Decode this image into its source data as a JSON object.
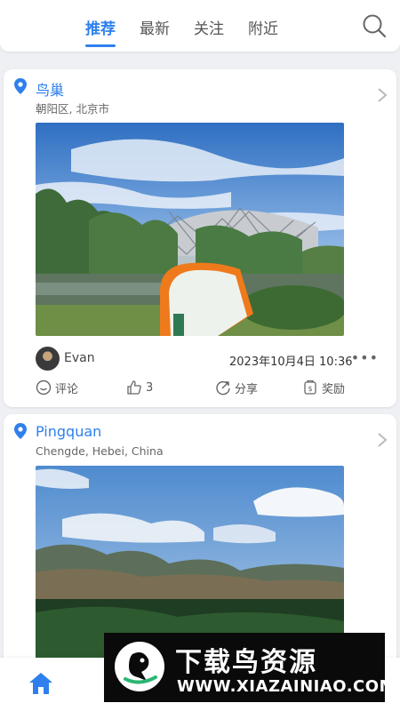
{
  "top_nav": {
    "tabs": [
      {
        "label": "推荐",
        "active": true
      },
      {
        "label": "最新",
        "active": false
      },
      {
        "label": "关注",
        "active": false
      },
      {
        "label": "附近",
        "active": false
      }
    ],
    "search_icon": "search-icon",
    "accent_color": "#2f80ed"
  },
  "posts": [
    {
      "place": "鸟巢",
      "address": "朝阳区, 北京市",
      "photo": "Beijing National Stadium (Bird's Nest) with trees and a curved signboard",
      "author": "Evan",
      "datetime": "2023年10月4日 10:36",
      "more": "•••",
      "actions": {
        "comment": "评论",
        "like_count": "3",
        "share": "分享",
        "reward": "奖励"
      }
    },
    {
      "place": "Pingquan",
      "address": "Chengde, Hebei, China",
      "photo": "Mountain landscape with green hills under a cloudy blue sky"
    }
  ],
  "bottom_nav": {
    "home_icon": "home-icon"
  },
  "watermark": {
    "title": "下载鸟资源",
    "url": "WWW.XIAZAINIAO.COM"
  }
}
